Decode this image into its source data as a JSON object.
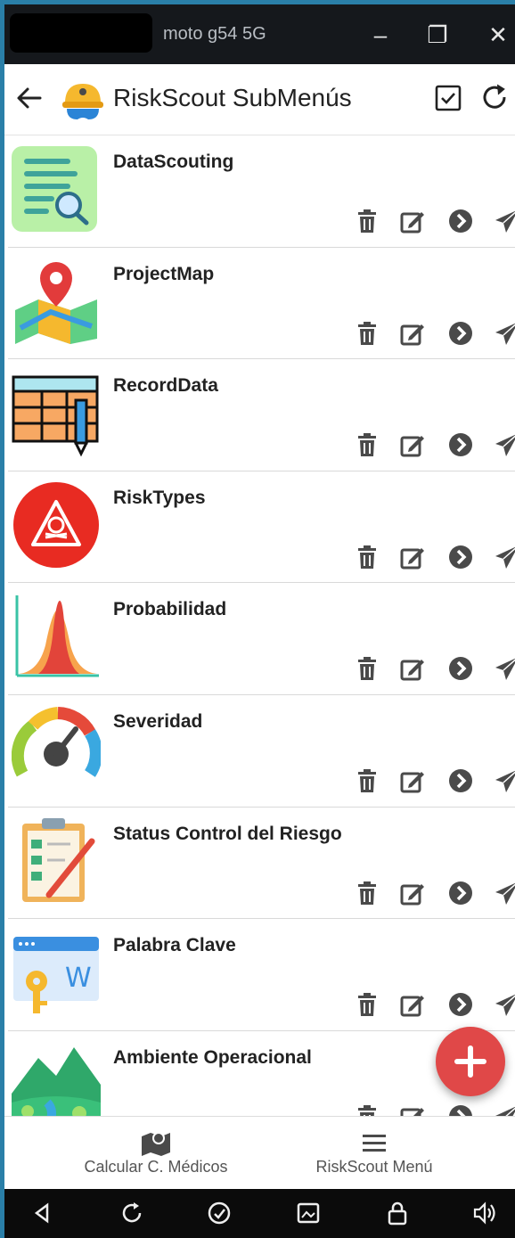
{
  "window": {
    "device_name": "moto g54 5G",
    "minimize_label": "–",
    "restore_label": "❐",
    "close_label": "✕"
  },
  "appbar": {
    "title": "RiskScout SubMenús",
    "back_icon": "arrow-left-icon",
    "logo_icon": "hard-hat-icon",
    "actions": [
      "checkbox-icon",
      "refresh-icon"
    ]
  },
  "items": [
    {
      "title": "DataScouting",
      "icon": "document-search-icon"
    },
    {
      "title": "ProjectMap",
      "icon": "map-pin-icon"
    },
    {
      "title": "RecordData",
      "icon": "table-pen-icon"
    },
    {
      "title": "RiskTypes",
      "icon": "hazard-skull-icon"
    },
    {
      "title": "Probabilidad",
      "icon": "distribution-chart-icon"
    },
    {
      "title": "Severidad",
      "icon": "gauge-icon"
    },
    {
      "title": "Status Control del Riesgo",
      "icon": "clipboard-check-icon"
    },
    {
      "title": "Palabra Clave",
      "icon": "key-window-icon"
    },
    {
      "title": "Ambiente Operacional",
      "icon": "landscape-icon"
    }
  ],
  "row_actions": [
    "trash-icon",
    "edit-icon",
    "chevron-circle-icon",
    "send-icon"
  ],
  "fab": {
    "icon": "plus-icon",
    "color": "#e04848"
  },
  "bottom_nav": [
    {
      "label": "Calcular C. Médicos",
      "icon": "map-icon"
    },
    {
      "label": "RiskScout Menú",
      "icon": "hamburger-icon"
    }
  ],
  "system_bar": [
    "back-triangle-icon",
    "rotate-icon",
    "auto-rotate-icon",
    "screenshot-icon",
    "lock-icon",
    "volume-icon"
  ],
  "colors": {
    "accent_red": "#e04848",
    "window_bar": "#15181c",
    "border": "#2a7fa8"
  }
}
